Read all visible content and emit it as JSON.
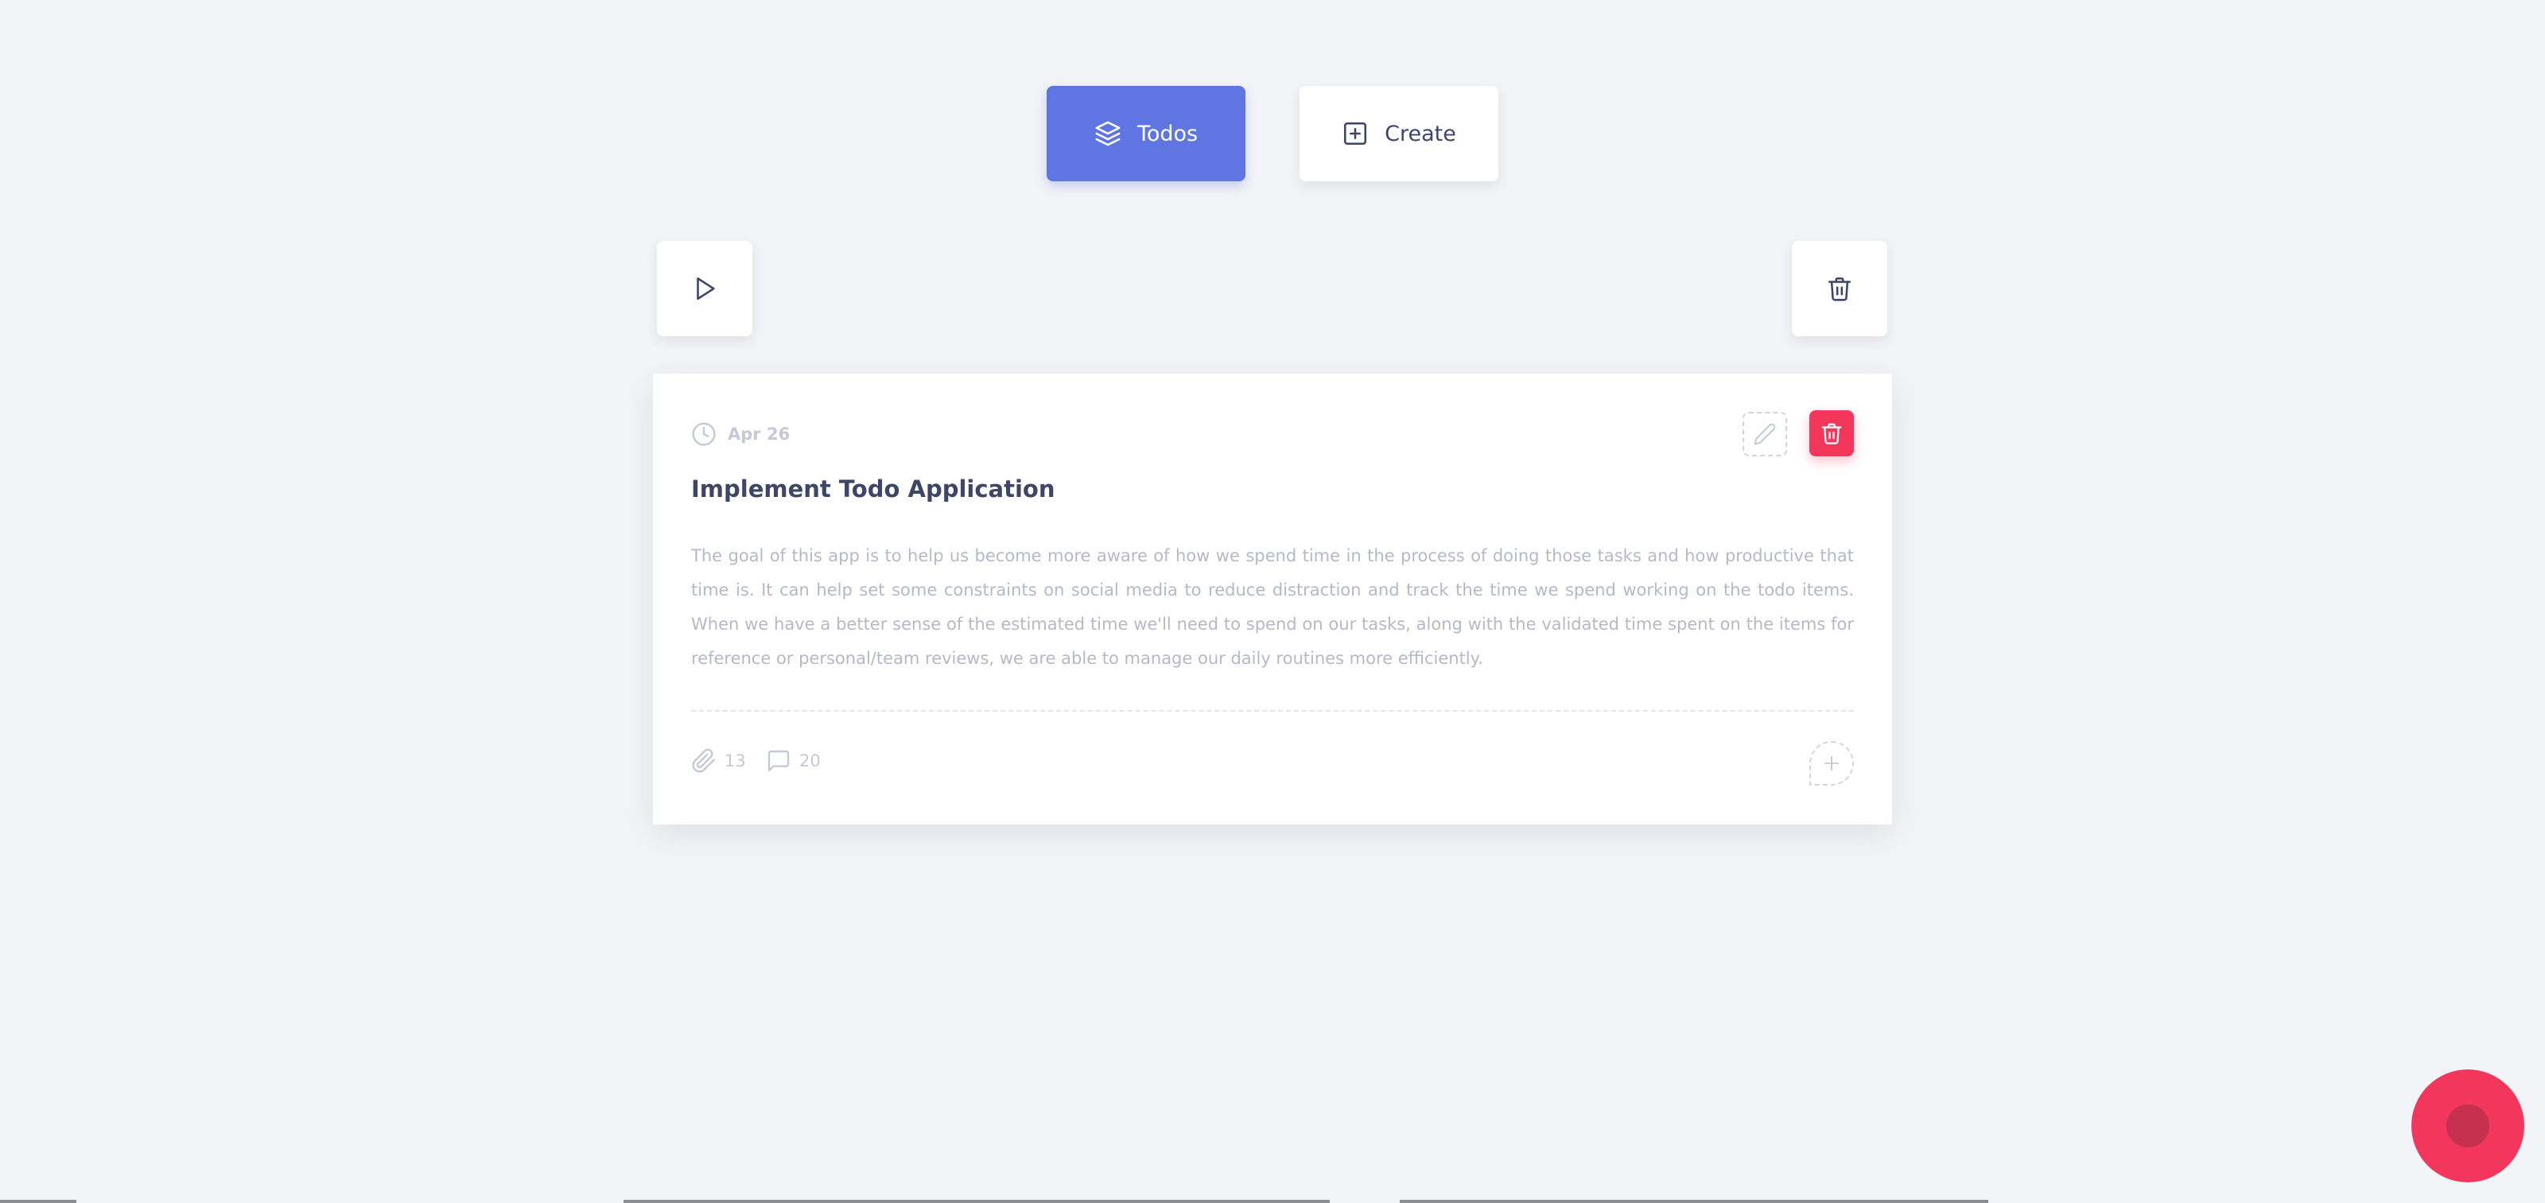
{
  "nav": {
    "todos_label": "Todos",
    "create_label": "Create"
  },
  "card": {
    "date": "Apr 26",
    "title": "Implement Todo Application",
    "description": "The goal of this app is to help us become more aware of how we spend time in the process of doing those tasks and how productive that time is. It can help set some constraints on social media to reduce distraction and track the time we spend working on the todo items. When we have a better sense of the estimated time we'll need to spend on our tasks, along with the validated time spent on the items for reference or personal/team reviews, we are able to manage our daily routines more efficiently.",
    "attachments_count": "13",
    "comments_count": "20"
  },
  "icons": {
    "todos": "layers-icon",
    "create": "plus-square-icon",
    "play": "play-icon",
    "trash": "trash-icon",
    "date": "clock-icon",
    "edit": "pencil-icon",
    "attachments": "paperclip-icon",
    "comments": "message-square-icon",
    "add": "plus-icon"
  },
  "colors": {
    "primary": "#5f75e2",
    "danger": "#f2365c",
    "background": "#f3f4f7",
    "text_dark": "#3d4666",
    "text_muted": "#b4b9c8"
  }
}
